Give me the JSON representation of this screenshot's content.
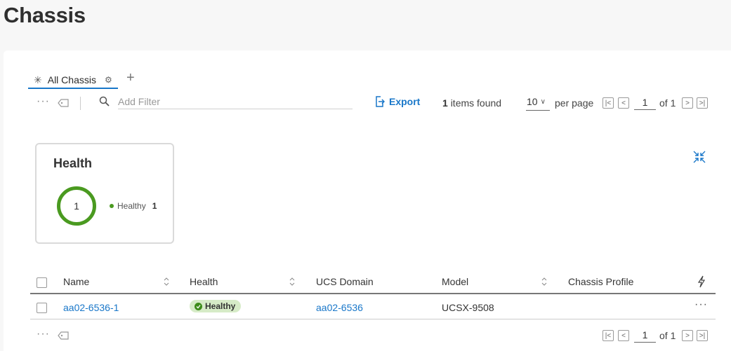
{
  "page": {
    "title": "Chassis"
  },
  "tabs": [
    {
      "label": "All Chassis"
    }
  ],
  "toolbar": {
    "filter_placeholder": "Add Filter",
    "export_label": "Export",
    "items_count": "1",
    "items_found_label": "items found",
    "per_page_value": "10",
    "per_page_label": "per page",
    "current_page": "1",
    "of_total": "of 1"
  },
  "health_widget": {
    "title": "Health",
    "total": "1",
    "legend": [
      {
        "label": "Healthy",
        "count": "1",
        "color": "#4a9a20"
      }
    ]
  },
  "table": {
    "columns": [
      "Name",
      "Health",
      "UCS Domain",
      "Model",
      "Chassis Profile"
    ],
    "rows": [
      {
        "name": "aa02-6536-1",
        "health": "Healthy",
        "ucs_domain": "aa02-6536",
        "model": "UCSX-9508",
        "chassis_profile": ""
      }
    ]
  },
  "bottom_pager": {
    "current_page": "1",
    "of_total": "of 1"
  },
  "colors": {
    "accent": "#1977c9",
    "healthy": "#4a9a20",
    "healthy_badge_bg": "#d6ebc7"
  }
}
